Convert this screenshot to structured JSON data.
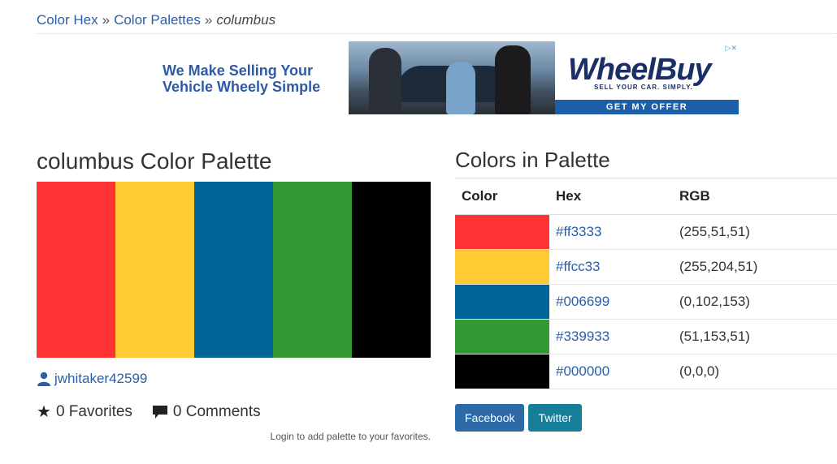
{
  "breadcrumb": {
    "home": "Color Hex",
    "section": "Color Palettes",
    "separator": "»",
    "current": "columbus"
  },
  "ad": {
    "headline": "We Make Selling Your Vehicle Wheely Simple",
    "brand": "WheelBuy",
    "tagline": "SELL YOUR CAR. SIMPLY.",
    "cta": "GET MY OFFER",
    "badge": "▷✕"
  },
  "palette": {
    "title": "columbus Color Palette",
    "colors": [
      "#ff3333",
      "#ffcc33",
      "#006699",
      "#339933",
      "#000000"
    ],
    "author": "jwhitaker42599",
    "favorites": "0 Favorites",
    "comments": "0 Comments",
    "login_note": "Login to add palette to your favorites."
  },
  "colors_table": {
    "title": "Colors in Palette",
    "headers": [
      "Color",
      "Hex",
      "RGB"
    ],
    "rows": [
      {
        "swatch": "#ff3333",
        "hex": "#ff3333",
        "rgb": "(255,51,51)"
      },
      {
        "swatch": "#ffcc33",
        "hex": "#ffcc33",
        "rgb": "(255,204,51)"
      },
      {
        "swatch": "#006699",
        "hex": "#006699",
        "rgb": "(0,102,153)"
      },
      {
        "swatch": "#339933",
        "hex": "#339933",
        "rgb": "(51,153,51)"
      },
      {
        "swatch": "#000000",
        "hex": "#000000",
        "rgb": "(0,0,0)"
      }
    ]
  },
  "share": {
    "facebook": "Facebook",
    "twitter": "Twitter"
  }
}
